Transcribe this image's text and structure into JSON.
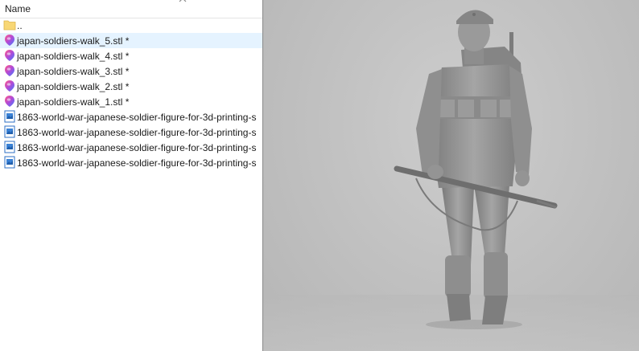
{
  "explorer": {
    "column_header": "Name",
    "items": [
      {
        "name": "..",
        "type": "folder",
        "selected": false
      },
      {
        "name": "japan-soldiers-walk_5.stl *",
        "type": "stl",
        "selected": true
      },
      {
        "name": "japan-soldiers-walk_4.stl *",
        "type": "stl",
        "selected": false
      },
      {
        "name": "japan-soldiers-walk_3.stl *",
        "type": "stl",
        "selected": false
      },
      {
        "name": "japan-soldiers-walk_2.stl *",
        "type": "stl",
        "selected": false
      },
      {
        "name": "japan-soldiers-walk_1.stl *",
        "type": "stl",
        "selected": false
      },
      {
        "name": "1863-world-war-japanese-soldier-figure-for-3d-printing-s",
        "type": "image",
        "selected": false
      },
      {
        "name": "1863-world-war-japanese-soldier-figure-for-3d-printing-s",
        "type": "image",
        "selected": false
      },
      {
        "name": "1863-world-war-japanese-soldier-figure-for-3d-printing-s",
        "type": "image",
        "selected": false
      },
      {
        "name": "1863-world-war-japanese-soldier-figure-for-3d-printing-s",
        "type": "image",
        "selected": false
      }
    ]
  },
  "colors": {
    "selection": "#e5f3ff",
    "folder": "#f8d775",
    "viewer_bg": "#c4c4c4",
    "model": "#8c8c8c"
  },
  "icons": {
    "folder": "folder-icon",
    "stl": "3d-model-file-icon",
    "image": "image-file-icon",
    "sort": "chevron-up-icon"
  }
}
